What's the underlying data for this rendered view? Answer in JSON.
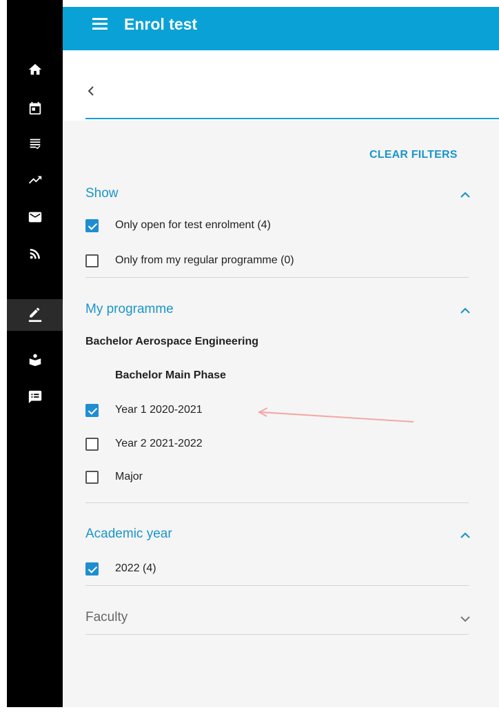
{
  "app": {
    "title": "Enrol test"
  },
  "sidebar": {
    "items": [
      {
        "icon": "home-icon"
      },
      {
        "icon": "calendar-icon"
      },
      {
        "icon": "checklist-icon"
      },
      {
        "icon": "trending-icon"
      },
      {
        "icon": "mail-icon"
      },
      {
        "icon": "rss-icon"
      },
      {
        "icon": "edit-icon",
        "active": true
      },
      {
        "icon": "reader-icon"
      },
      {
        "icon": "feedback-icon"
      }
    ]
  },
  "filters": {
    "clear_label": "CLEAR FILTERS",
    "show": {
      "title": "Show",
      "options": [
        {
          "label": "Only open for test enrolment (4)",
          "checked": true
        },
        {
          "label": "Only from my regular programme (0)",
          "checked": false
        }
      ]
    },
    "programme": {
      "title": "My programme",
      "name": "Bachelor Aerospace Engineering",
      "phase": "Bachelor Main Phase",
      "options": [
        {
          "label": "Year 1 2020-2021",
          "checked": true
        },
        {
          "label": "Year 2 2021-2022",
          "checked": false
        },
        {
          "label": "Major",
          "checked": false
        }
      ]
    },
    "academic_year": {
      "title": "Academic year",
      "options": [
        {
          "label": "2022 (4)",
          "checked": true
        }
      ]
    },
    "faculty": {
      "title": "Faculty"
    }
  },
  "colors": {
    "accent": "#0aa2d6",
    "link": "#1a95c9",
    "checkbox": "#1e8ed1",
    "annotation": "#f4a6a6"
  }
}
